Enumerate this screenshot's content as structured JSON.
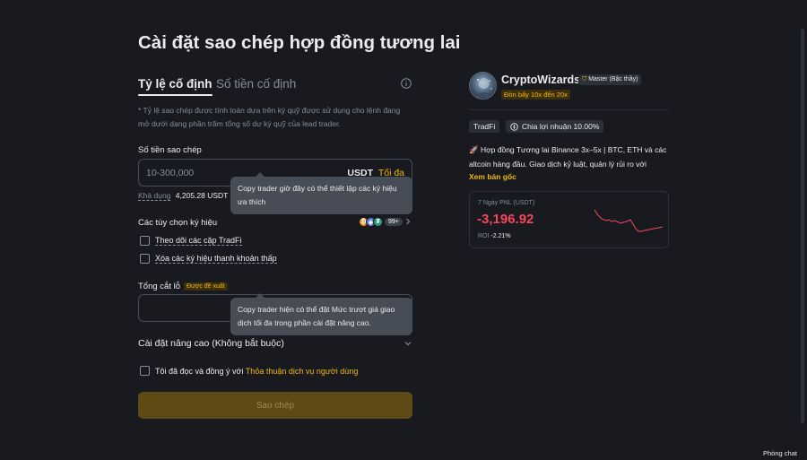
{
  "page": {
    "title": "Cài đặt sao chép hợp đồng tương lai"
  },
  "tabs": {
    "fixed_ratio": "Tỷ lệ cố định",
    "fixed_amount": "Số tiền cố định"
  },
  "description": "* Tỷ lệ sao chép được tính toán dựa trên ký quỹ được sử dụng cho lệnh đang mở dưới dạng phần trăm tổng số dư ký quỹ của lead trader.",
  "copy_amount": {
    "label": "Số tiền sao chép",
    "placeholder": "10-300,000",
    "unit": "USDT",
    "max_label": "Tối đa",
    "available_label": "Khả dụng",
    "available_value": "4,205.28 USDT"
  },
  "tooltips": {
    "symbol_settings": "Copy trader giờ đây có thể thiết lập các ký hiệu ưa thích",
    "slippage": "Copy trader hiện có thể đặt Mức trượt giá giao dịch tối đa trong phần cài đặt nâng cao."
  },
  "symbol_options": {
    "label": "Các tùy chọn ký hiệu",
    "more_count": "99+",
    "follow_tradfi": "Theo dõi các cặp TradFi",
    "remove_low_liquidity": "Xóa các ký hiệu thanh khoản thấp"
  },
  "stop_loss": {
    "label": "Tổng cắt lỗ",
    "badge": "Được đề xuất"
  },
  "advanced": {
    "label": "Cài đặt nâng cao (Không bắt buộc)"
  },
  "agreement": {
    "text": "Tôi đã đọc và đồng ý với",
    "link": "Thỏa thuận dịch vụ người dùng"
  },
  "submit": {
    "label": "Sao chép"
  },
  "trader": {
    "name": "CryptoWizards",
    "level": "Master (Bậc thầy)",
    "leverage": "Đòn bẩy 10x đến 20x",
    "tags": {
      "tradfi": "TradFi",
      "profit_share": "Chia lợi nhuận 10.00%"
    },
    "bio": "🚀 Hợp đồng Tương lai Binance 3x–5x | BTC, ETH và các altcoin hàng đầu. Giao dịch kỷ luật, quản lý rủi ro với",
    "see_original": "Xem bản gốc",
    "pnl_label": "7 Ngày PNL (USDT)",
    "pnl_value": "-3,196.92",
    "roi_label": "ROI",
    "roi_value": "-2.21%"
  },
  "footer": {
    "chat": "Phòng chat"
  },
  "colors": {
    "accent": "#f0b90b",
    "negative": "#f6465d",
    "background": "#181a20"
  }
}
